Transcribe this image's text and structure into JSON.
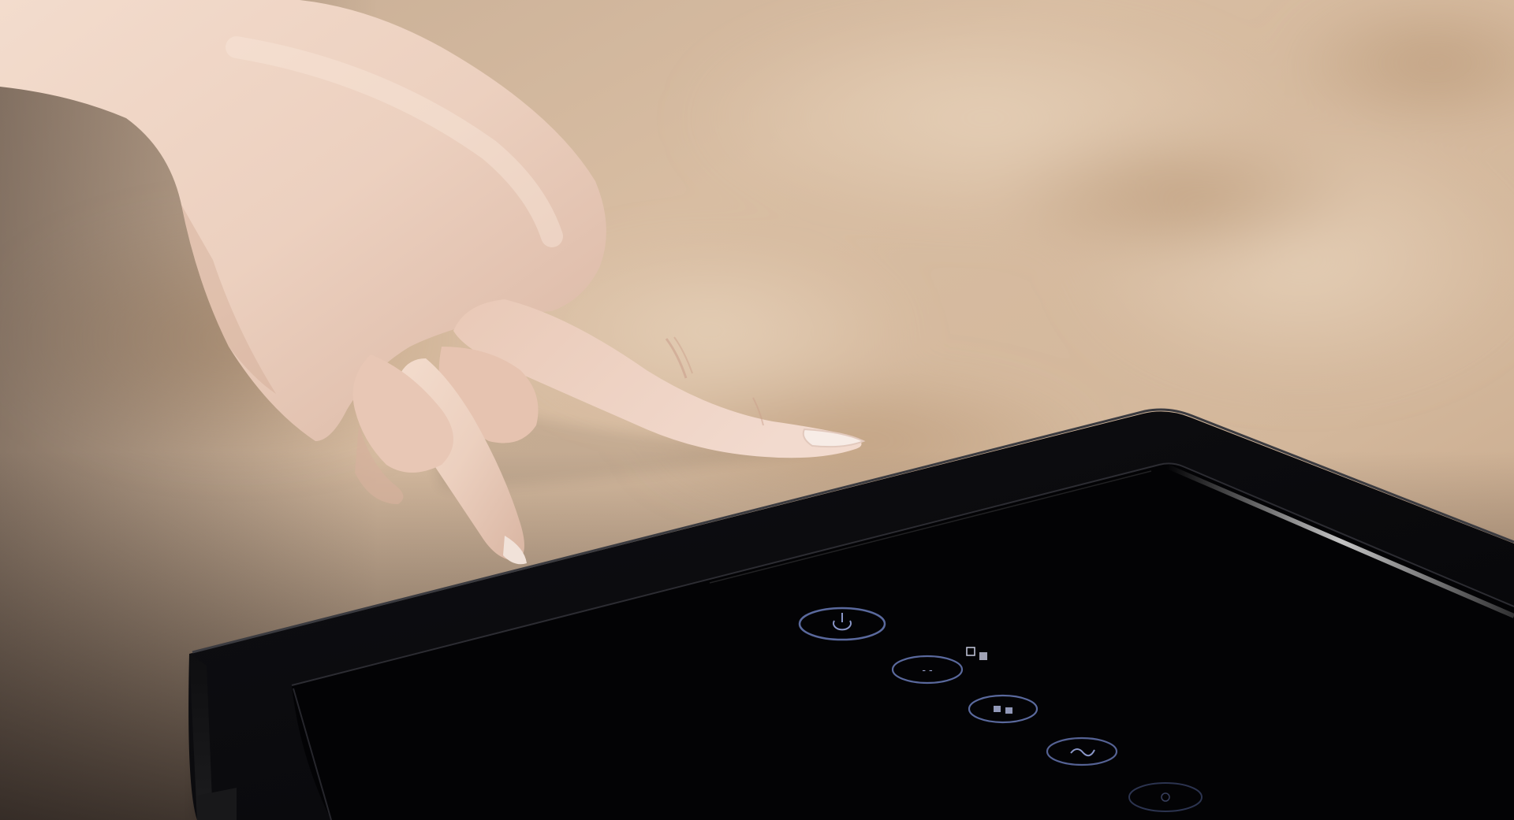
{
  "scene": {
    "subject": "hand-touching-control-panel",
    "panel_buttons": [
      {
        "icon": "power-icon"
      },
      {
        "icon": "mode-icon"
      },
      {
        "icon": "filter-icon"
      },
      {
        "icon": "speed-icon"
      },
      {
        "icon": "timer-icon"
      }
    ],
    "indicator_icons": [
      "status-indicator-icon",
      "status-indicator-icon"
    ]
  },
  "colors": {
    "background_warm": "#d8bda1",
    "background_light": "#e5cfb6",
    "background_dark": "#b89a7d",
    "skin": "#efd2c2",
    "skin_shadow": "#c9a593",
    "device_body": "#0c0c0e",
    "device_glass": "#040406",
    "button_ring": "#6a7bb8",
    "highlight": "#d8d8dc"
  }
}
